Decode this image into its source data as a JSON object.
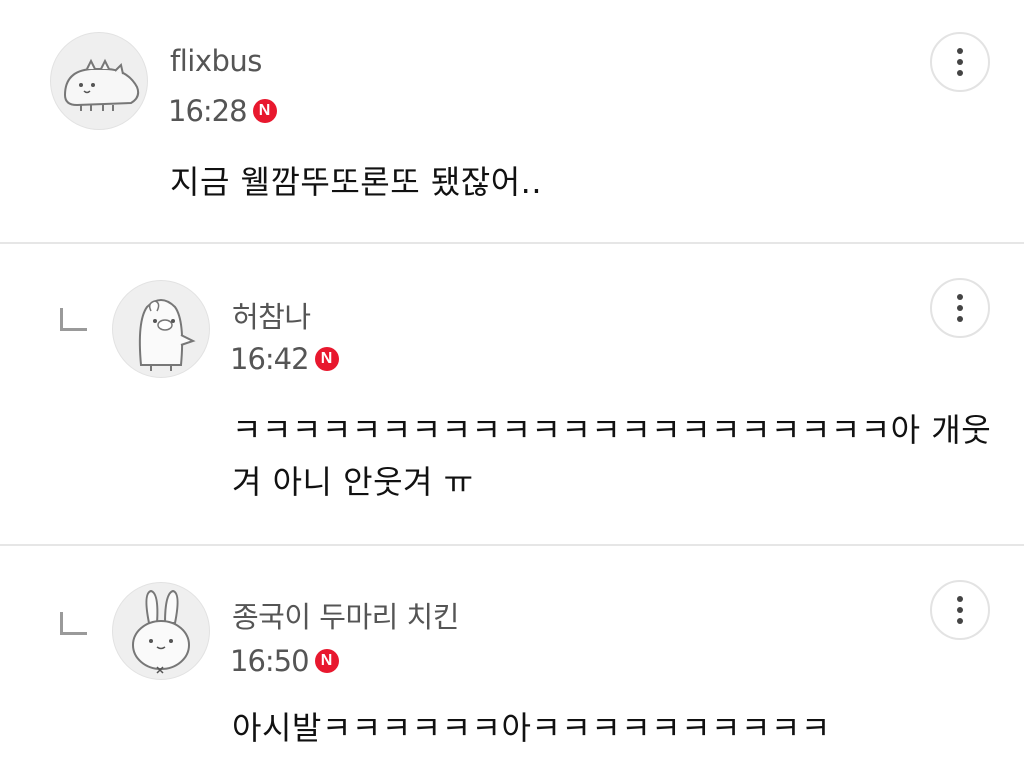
{
  "comments": [
    {
      "author": "flixbus",
      "time": "16:28",
      "badge": "N",
      "text": "지금 웰깜뚜또론또 됐잖어..",
      "is_reply": false,
      "avatar": "dinosaur-avatar"
    },
    {
      "author": "허참나",
      "time": "16:42",
      "badge": "N",
      "text": "ㅋㅋㅋㅋㅋㅋㅋㅋㅋㅋㅋㅋㅋㅋㅋㅋㅋㅋㅋㅋㅋㅋ아 개웃겨 아니 안웃겨 ㅠ",
      "is_reply": true,
      "avatar": "penguin-avatar"
    },
    {
      "author": "종국이 두마리 치킨",
      "time": "16:50",
      "badge": "N",
      "text": "아시발ㅋㅋㅋㅋㅋㅋ아ㅋㅋㅋㅋㅋㅋㅋㅋㅋㅋ",
      "is_reply": true,
      "avatar": "rabbit-avatar"
    }
  ],
  "icons": {
    "more": "more-vertical-icon",
    "reply": "reply-indent-icon",
    "new_badge": "new-badge-icon"
  },
  "colors": {
    "badge": "#e8182e",
    "meta_text": "#555555",
    "divider": "#e6e6e6"
  }
}
